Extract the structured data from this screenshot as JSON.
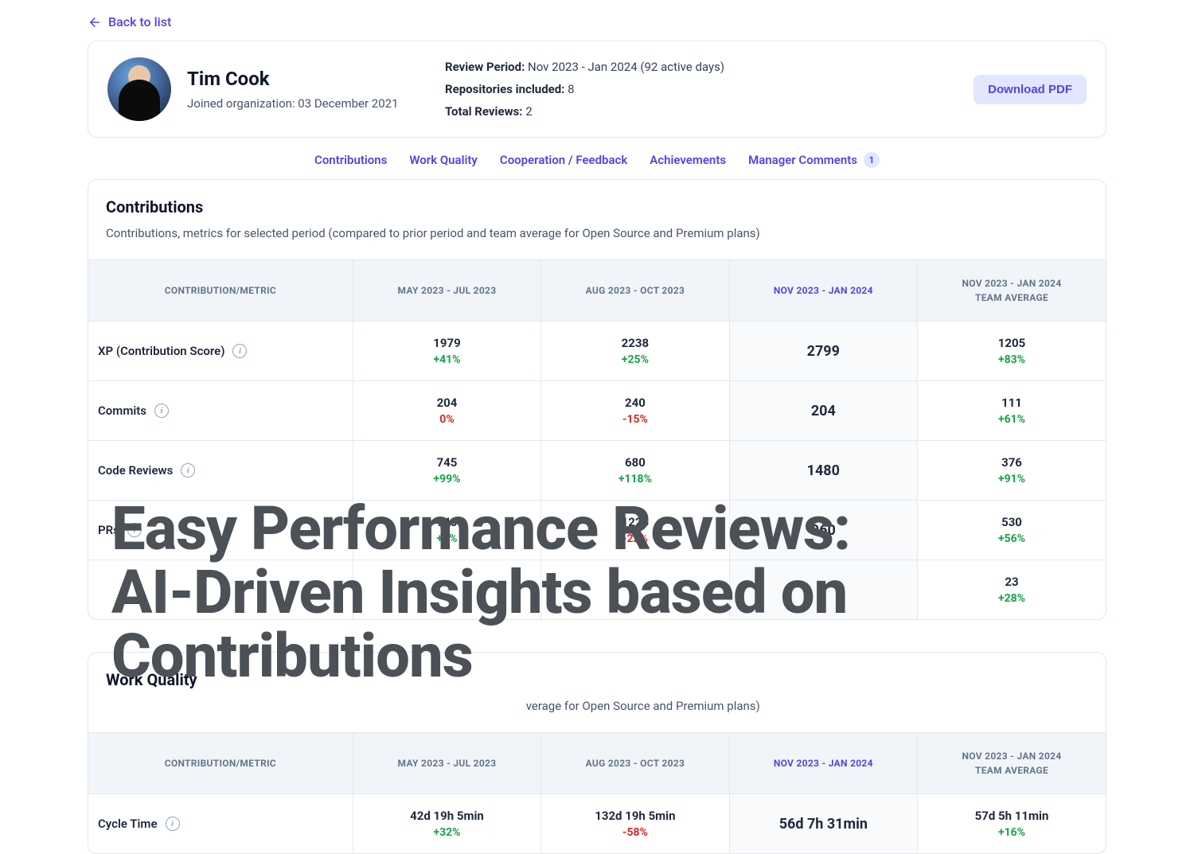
{
  "backLabel": "Back to list",
  "profile": {
    "name": "Tim Cook",
    "joined": "Joined organization: 03 December 2021",
    "reviewPeriodLabel": "Review Period:",
    "reviewPeriodValue": " Nov 2023 - Jan 2024 (92 active days)",
    "reposLabel": "Repositories included:",
    "reposValue": " 8",
    "reviewsLabel": "Total Reviews:",
    "reviewsValue": " 2",
    "downloadLabel": "Download PDF"
  },
  "tabs": {
    "contributions": "Contributions",
    "workQuality": "Work Quality",
    "cooperation": "Cooperation / Feedback",
    "achievements": "Achievements",
    "managerComments": "Manager Comments",
    "managerCommentsCount": "1"
  },
  "columns": {
    "metric": "CONTRIBUTION/METRIC",
    "p1": "MAY 2023 - JUL 2023",
    "p2": "AUG 2023 - OCT 2023",
    "current": "NOV 2023 - JAN 2024",
    "teamTop": "NOV 2023 - JAN 2024",
    "teamBottom": "TEAM AVERAGE"
  },
  "contribSection": {
    "title": "Contributions",
    "sub": "Contributions, metrics for selected period (compared to prior period and team average for Open Source and Premium plans)"
  },
  "contribRows": [
    {
      "name": "XP (Contribution Score)",
      "p1v": "1979",
      "p1d": "+41%",
      "p1s": "pos",
      "p2v": "2238",
      "p2d": "+25%",
      "p2s": "pos",
      "cur": "2799",
      "tv": "1205",
      "td": "+83%",
      "ts": "pos"
    },
    {
      "name": "Commits",
      "p1v": "204",
      "p1d": "0%",
      "p1s": "neg",
      "p2v": "240",
      "p2d": "-15%",
      "p2s": "neg",
      "cur": "204",
      "tv": "111",
      "td": "+61%",
      "ts": "pos"
    },
    {
      "name": "Code Reviews",
      "p1v": "745",
      "p1d": "+99%",
      "p1s": "pos",
      "p2v": "680",
      "p2d": "+118%",
      "p2s": "pos",
      "cur": "1480",
      "tv": "376",
      "td": "+91%",
      "ts": "pos"
    },
    {
      "name": "PRs",
      "p1v": "940",
      "p1d": "+2%",
      "p1s": "pos",
      "p2v": "1225",
      "p2d": "-22%",
      "p2s": "neg",
      "cur": "960",
      "tv": "530",
      "td": "+56%",
      "ts": "pos"
    },
    {
      "name": "",
      "p1v": "",
      "p1d": "",
      "p1s": "neg",
      "p2v": "",
      "p2d": "",
      "p2s": "neg",
      "cur": "",
      "tv": "23",
      "td": "+28%",
      "ts": "pos"
    }
  ],
  "workSection": {
    "title": "Work Quality",
    "subSuffix": "verage for Open Source and Premium plans)"
  },
  "workRows": [
    {
      "name": "Cycle Time",
      "p1v": "42d 19h 5min",
      "p1d": "+32%",
      "p1s": "pos",
      "p2v": "132d 19h 5min",
      "p2d": "-58%",
      "p2s": "neg",
      "cur": "56d 7h 31min",
      "tv": "57d 5h 11min",
      "td": "+16%",
      "ts": "pos"
    }
  ],
  "heroLine1": "Easy Performance Reviews:",
  "heroLine2": "AI-Driven Insights based on",
  "heroLine3": "Contributions"
}
